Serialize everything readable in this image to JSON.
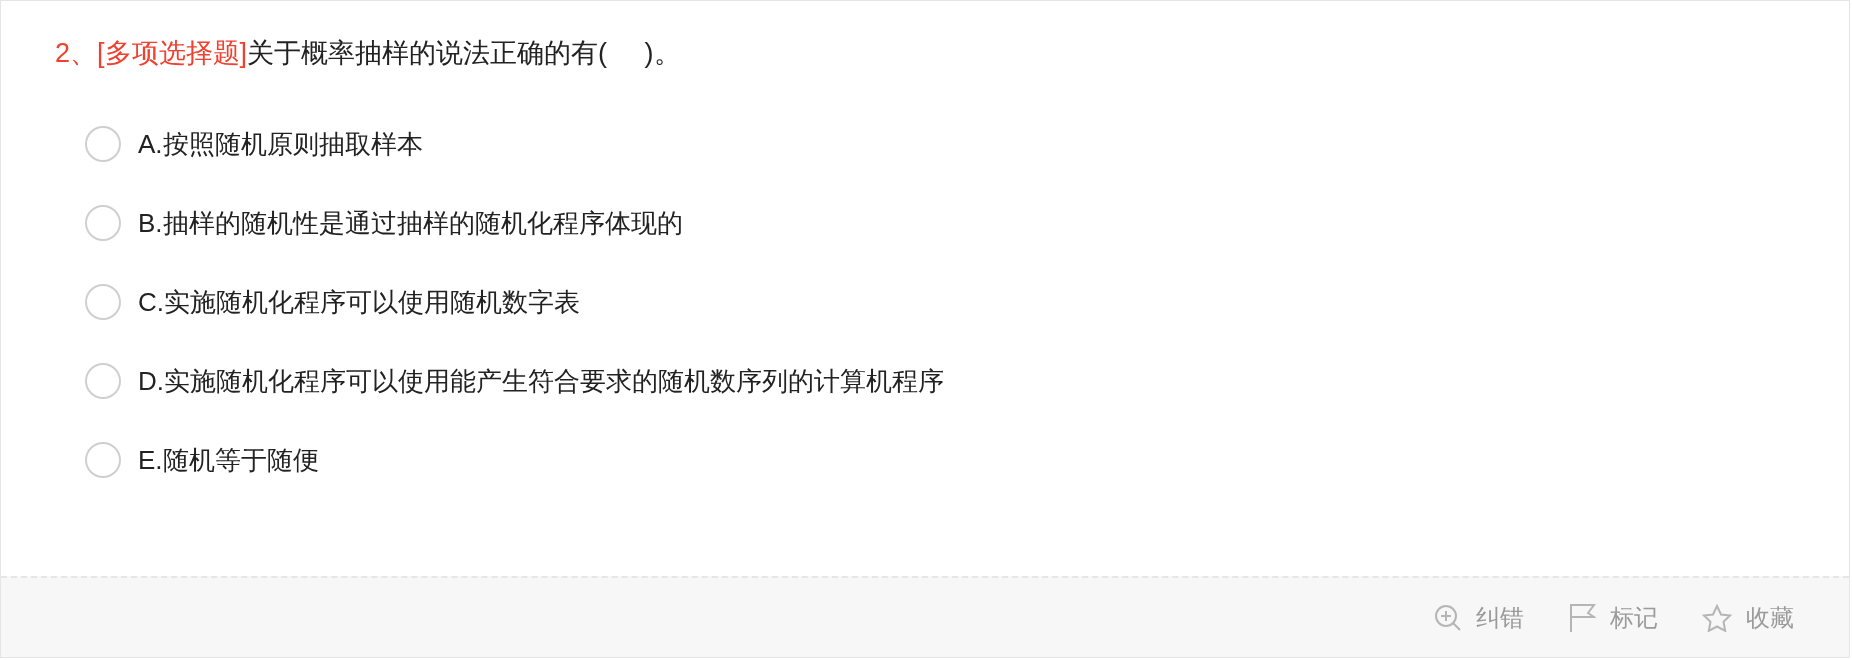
{
  "question": {
    "number": "2、",
    "type": "[多项选择题]",
    "text": "关于概率抽样的说法正确的有(     )。"
  },
  "options": [
    {
      "label": "A.按照随机原则抽取样本",
      "selected": false
    },
    {
      "label": "B.抽样的随机性是通过抽样的随机化程序体现的",
      "selected": false
    },
    {
      "label": "C.实施随机化程序可以使用随机数字表",
      "selected": false
    },
    {
      "label": "D.实施随机化程序可以使用能产生符合要求的随机数序列的计算机程序",
      "selected": false
    },
    {
      "label": "E.随机等于随便",
      "selected": false
    }
  ],
  "actions": [
    {
      "kind": "correct",
      "label": "纠错"
    },
    {
      "kind": "mark",
      "label": "标记"
    },
    {
      "kind": "favorite",
      "label": "收藏"
    }
  ]
}
